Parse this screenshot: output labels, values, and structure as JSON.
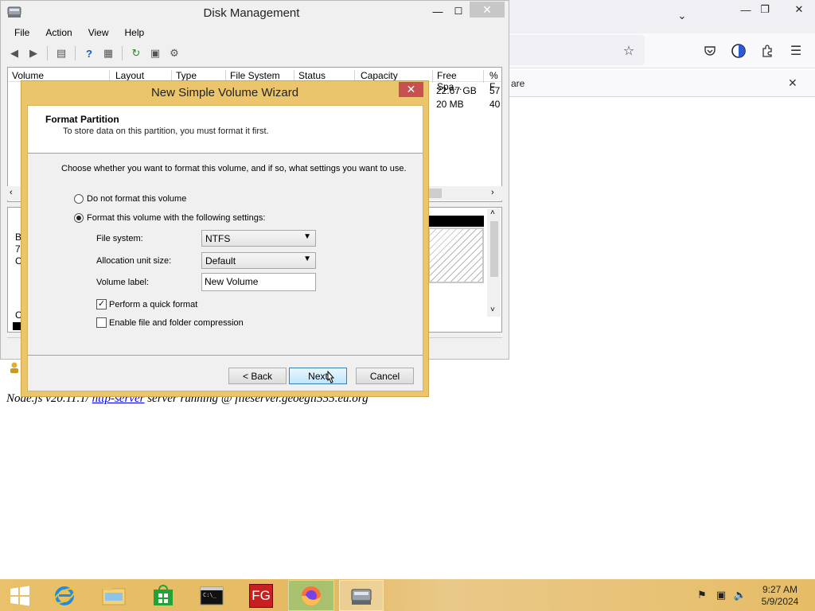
{
  "disk_management": {
    "title": "Disk Management",
    "menu": [
      "File",
      "Action",
      "View",
      "Help"
    ],
    "columns": [
      "Volume",
      "Layout",
      "Type",
      "File System",
      "Status",
      "Capacity",
      "Free Spa...",
      "% F"
    ],
    "rows": [
      {
        "free": "22.67 GB",
        "pct": "57"
      },
      {
        "free": "20 MB",
        "pct": "40"
      }
    ],
    "lower_labels": [
      "B",
      "7",
      "C",
      "C"
    ]
  },
  "wizard": {
    "title": "New Simple Volume Wizard",
    "heading": "Format Partition",
    "subheading": "To store data on this partition, you must format it first.",
    "intro": "Choose whether you want to format this volume, and if so, what settings you want to use.",
    "option_no_format": "Do not format this volume",
    "option_format": "Format this volume with the following settings:",
    "file_system_label": "File system:",
    "file_system_value": "NTFS",
    "allocation_label": "Allocation unit size:",
    "allocation_value": "Default",
    "volume_label_label": "Volume label:",
    "volume_label_value": "New Volume",
    "quick_format_label": "Perform a quick format",
    "quick_format_checked": true,
    "compression_label": "Enable file and folder compression",
    "compression_checked": false,
    "back_label": "< Back",
    "next_label": "Next",
    "cancel_label": "Cancel"
  },
  "browser": {
    "notification_fragment": "are",
    "page_text_prefix": "Node.js v20.11.1/ ",
    "page_link": "http-server",
    "page_text_suffix": " server running @ fileserver.geoegil555.eu.org"
  },
  "taskbar": {
    "time": "9:27 AM",
    "date": "5/9/2024",
    "fg_label": "FG",
    "colors": {
      "accent": "#e9c16a",
      "close_red": "#c75050"
    }
  }
}
